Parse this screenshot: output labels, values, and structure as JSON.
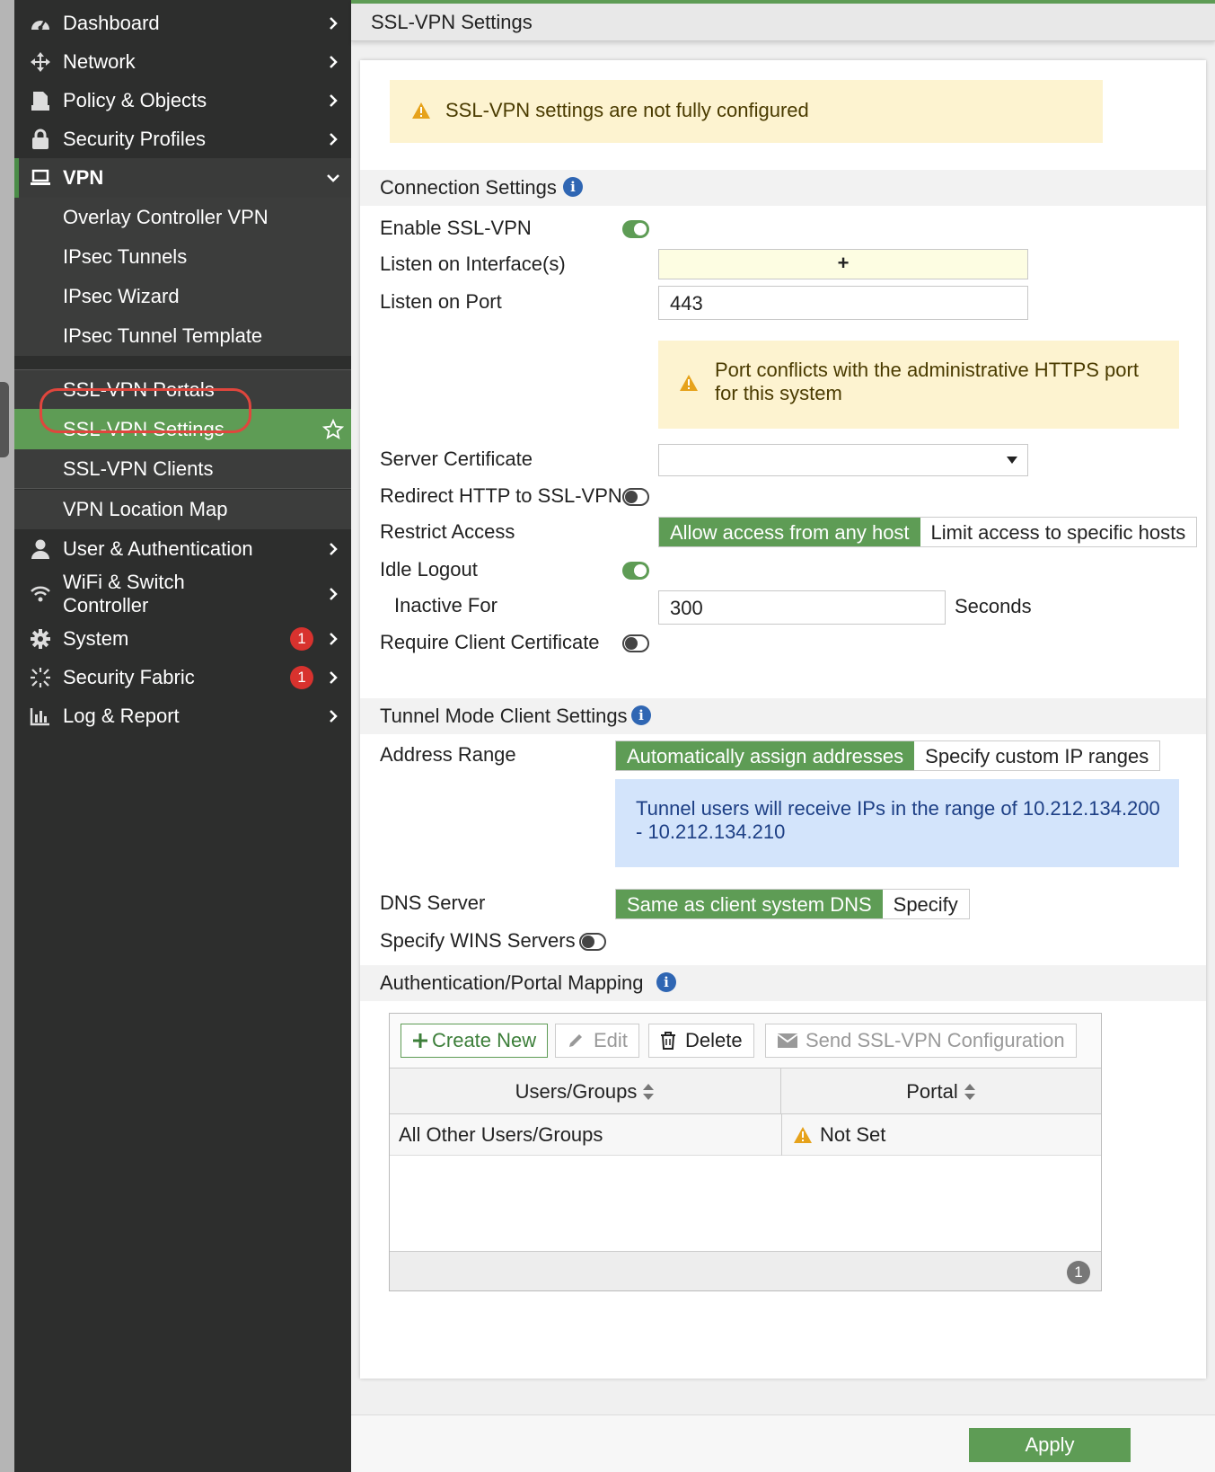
{
  "sidebar": {
    "items": [
      {
        "label": "Dashboard",
        "icon": "dashboard-icon"
      },
      {
        "label": "Network",
        "icon": "network-icon"
      },
      {
        "label": "Policy & Objects",
        "icon": "policy-icon"
      },
      {
        "label": "Security Profiles",
        "icon": "lock-icon"
      },
      {
        "label": "VPN",
        "icon": "laptop-icon"
      },
      {
        "label": "User & Authentication",
        "icon": "user-icon"
      },
      {
        "label": "WiFi & Switch",
        "label2": "Controller",
        "icon": "wifi-icon"
      },
      {
        "label": "System",
        "icon": "gear-icon",
        "badge": "1"
      },
      {
        "label": "Security Fabric",
        "icon": "fabric-icon",
        "badge": "1"
      },
      {
        "label": "Log & Report",
        "icon": "chart-icon"
      }
    ],
    "vpn_sub": [
      "Overlay Controller VPN",
      "IPsec Tunnels",
      "IPsec Wizard",
      "IPsec Tunnel Template",
      "SSL-VPN Portals",
      "SSL-VPN Settings",
      "SSL-VPN Clients",
      "VPN Location Map"
    ]
  },
  "header": {
    "title": "SSL-VPN Settings"
  },
  "warning": {
    "text": "SSL-VPN settings are not fully configured"
  },
  "connection": {
    "section_title": "Connection Settings",
    "enable_label": "Enable SSL-VPN",
    "enable": true,
    "listen_iface_label": "Listen on Interface(s)",
    "add_symbol": "+",
    "listen_port_label": "Listen on Port",
    "listen_port": "443",
    "port_warning": "Port conflicts with the administrative HTTPS port for this system",
    "server_cert_label": "Server Certificate",
    "server_cert_value": "",
    "redirect_label": "Redirect HTTP to SSL-VPN",
    "redirect": false,
    "restrict_label": "Restrict Access",
    "restrict_options": [
      "Allow access from any host",
      "Limit access to specific hosts"
    ],
    "idle_logout_label": "Idle Logout",
    "idle_logout": true,
    "inactive_label": "Inactive For",
    "inactive_value": "300",
    "inactive_unit": "Seconds",
    "client_cert_label": "Require Client Certificate",
    "client_cert": false
  },
  "tunnel": {
    "section_title": "Tunnel Mode Client Settings",
    "address_range_label": "Address Range",
    "address_options": [
      "Automatically assign addresses",
      "Specify custom IP ranges"
    ],
    "range_info": "Tunnel users will receive IPs in the range of 10.212.134.200 - 10.212.134.210",
    "dns_label": "DNS Server",
    "dns_options": [
      "Same as client system DNS",
      "Specify"
    ],
    "wins_label": "Specify WINS Servers",
    "wins": false
  },
  "mapping": {
    "section_title": "Authentication/Portal Mapping",
    "toolbar": {
      "create": "Create New",
      "edit": "Edit",
      "delete": "Delete",
      "send": "Send SSL-VPN Configuration"
    },
    "columns": [
      "Users/Groups",
      "Portal"
    ],
    "rows": [
      {
        "users": "All Other Users/Groups",
        "portal": "Not Set"
      }
    ],
    "count": "1"
  },
  "footer": {
    "apply": "Apply"
  },
  "colors": {
    "accent": "#5e9c55",
    "sidebar": "#2d2e2d",
    "warning_bg": "#fdf3d0",
    "info_bg": "#d3e4fb",
    "badge": "#d8322e"
  }
}
